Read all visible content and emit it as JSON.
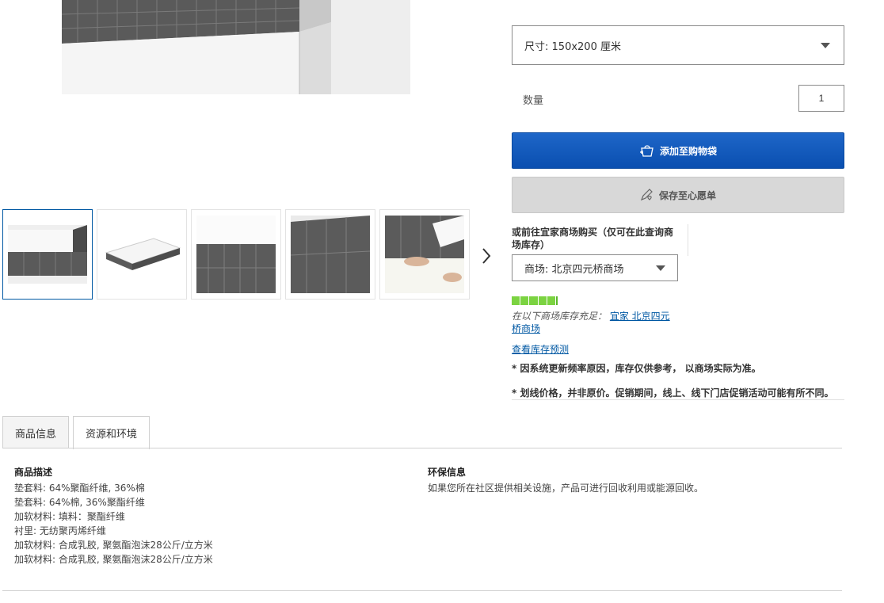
{
  "product": {
    "size_select": {
      "label": "尺寸:",
      "value": "150x200 厘米"
    },
    "quantity": {
      "label": "数量",
      "value": "1"
    },
    "add_to_cart_label": "添加至购物袋",
    "add_to_wishlist_label": "保存至心愿单"
  },
  "store": {
    "title": "或前往宜家商场购买（仅可在此查询商场库存）",
    "select": {
      "label": "商场:",
      "value": "北京四元桥商场"
    },
    "stock_level_fraction": 1.0,
    "stock_text": "在以下商场库存充足：",
    "stock_store_link": "宜家 北京四元桥商场",
    "forecast_link": "查看库存预测",
    "note1": "* 因系统更新频率原因，库存仅供参考， 以商场实际为准。",
    "note2": "* 划线价格，并非原价。促销期间，线上、线下门店促销活动可能有所不同。"
  },
  "tabs": [
    {
      "label": "商品信息"
    },
    {
      "label": "资源和环境"
    }
  ],
  "description": {
    "title": "商品描述",
    "lines": [
      "垫套料: 64%聚酯纤维, 36%棉",
      "垫套料: 64%棉, 36%聚酯纤维",
      "加软材料: 填料：聚酯纤维",
      "衬里: 无纺聚丙烯纤维",
      "加软材料: 合成乳胶, 聚氨酯泡沫28公斤/立方米",
      "加软材料: 合成乳胶, 聚氨酯泡沫28公斤/立方米"
    ]
  },
  "environment": {
    "title": "环保信息",
    "text": "如果您所在社区提供相关设施，产品可进行回收利用或能源回收。"
  },
  "icons": {
    "cart": "shopping-bag-icon",
    "wishlist": "edit-heart-icon",
    "next": "chevron-right-icon",
    "dropdown": "caret-down-icon"
  },
  "colors": {
    "primary_button": "#0a58c2",
    "secondary_button": "#d8d8d8",
    "stock_green": "#7bd341",
    "link": "#0058a3"
  }
}
